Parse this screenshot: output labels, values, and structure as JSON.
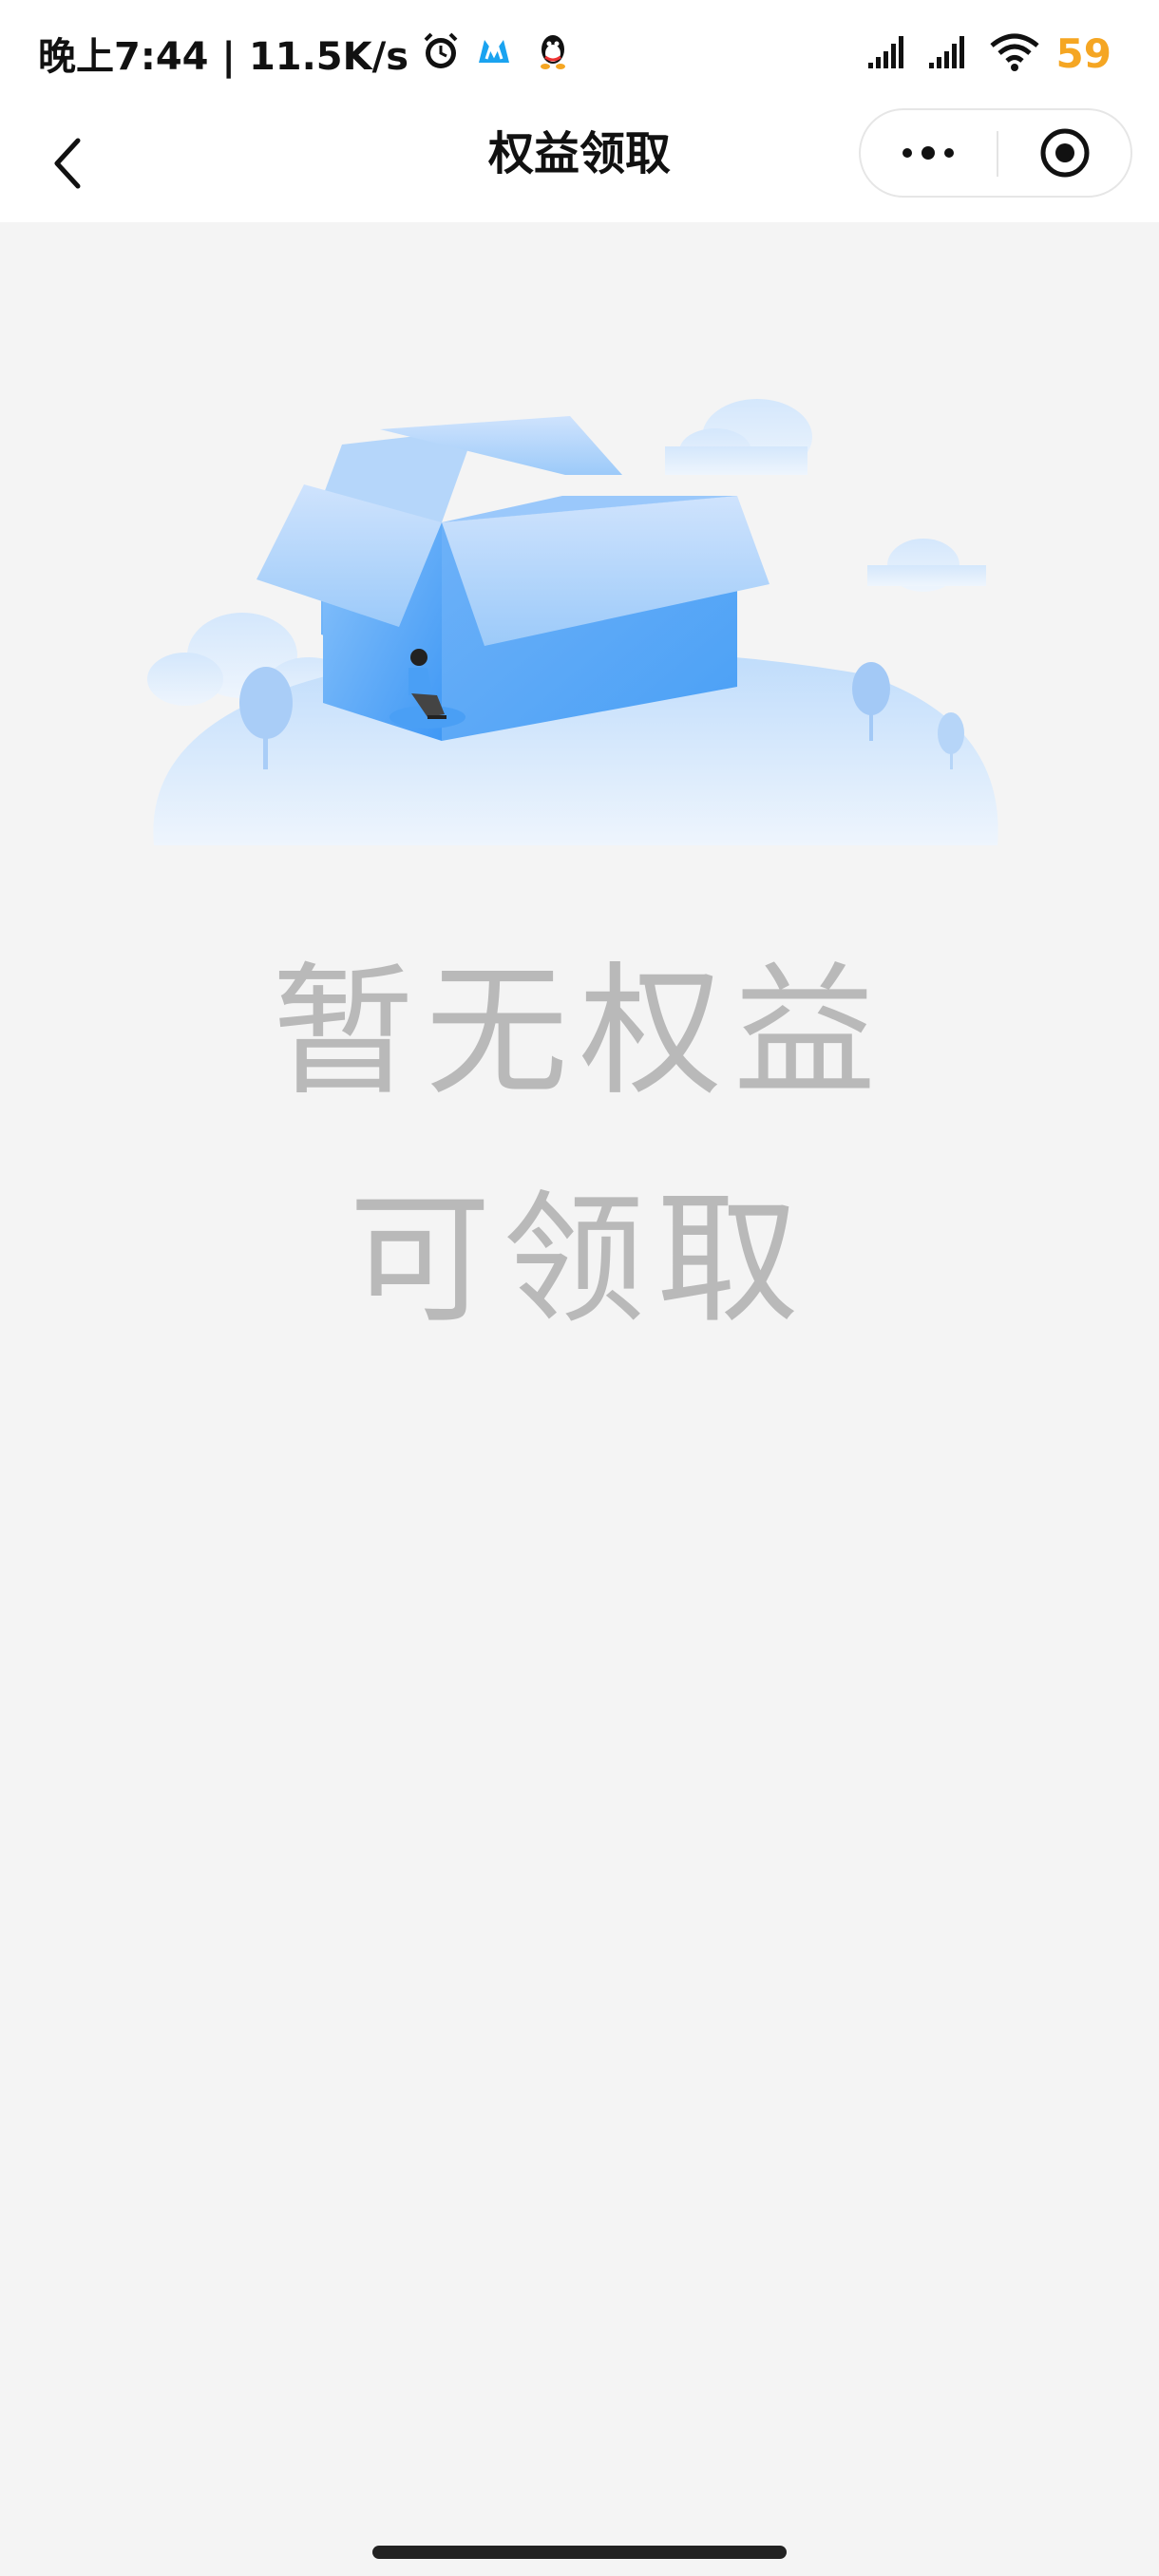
{
  "status_bar": {
    "time_speed": "晚上7:44 | 11.5K/s",
    "battery": "59",
    "battery_color": "#f5a623"
  },
  "nav": {
    "title": "权益领取"
  },
  "empty_state": {
    "line1": "暂无权益",
    "line2": "可领取"
  },
  "colors": {
    "background": "#f4f4f4",
    "empty_text": "#b9b9b9",
    "illustration_blue": "#4a9ff5"
  }
}
